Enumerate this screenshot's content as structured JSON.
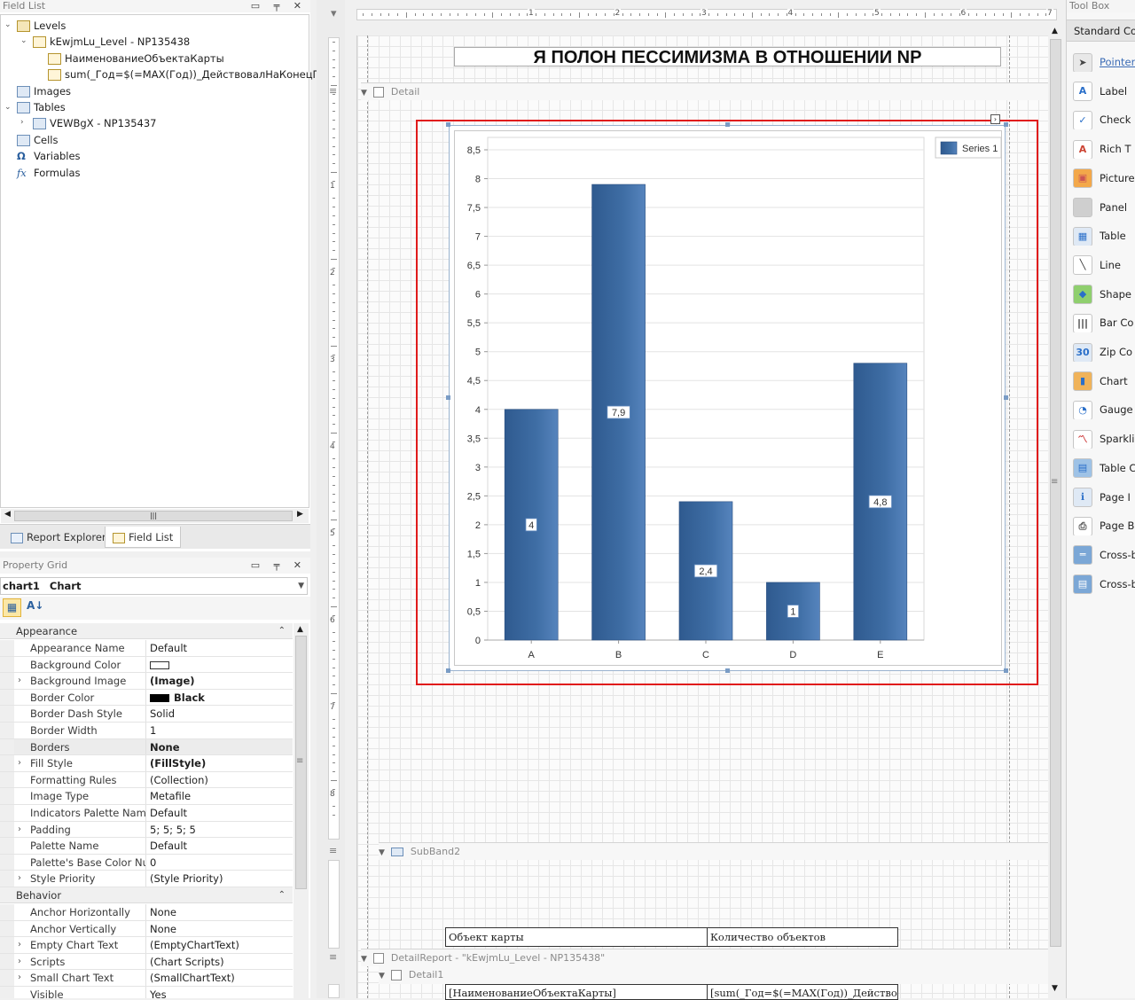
{
  "field_list": {
    "title": "Field List",
    "items": [
      {
        "label": "Levels"
      },
      {
        "label": "kEwjmLu_Level - NP135438"
      },
      {
        "label": "НаименованиеОбъектаКарты"
      },
      {
        "label": "sum(_Год=$(=MAX(Год))_ДействовалНаКонецГода)"
      },
      {
        "label": "Images"
      },
      {
        "label": "Tables"
      },
      {
        "label": "VEWBgX - NP135437"
      },
      {
        "label": "Cells"
      },
      {
        "label": "Variables"
      },
      {
        "label": "Formulas"
      }
    ],
    "tabs": [
      "Report Explorer",
      "Field List"
    ]
  },
  "property_grid": {
    "title": "Property Grid",
    "selected_object": "chart1",
    "selected_type": "Chart",
    "categories": [
      {
        "name": "Appearance",
        "rows": [
          {
            "key": "Appearance Name",
            "value": "Default"
          },
          {
            "key": "Background Color",
            "value": ""
          },
          {
            "key": "Background Image",
            "value": "(Image)"
          },
          {
            "key": "Border Color",
            "value": "Black"
          },
          {
            "key": "Border Dash Style",
            "value": "Solid"
          },
          {
            "key": "Border Width",
            "value": "1"
          },
          {
            "key": "Borders",
            "value": "None"
          },
          {
            "key": "Fill Style",
            "value": "(FillStyle)"
          },
          {
            "key": "Formatting Rules",
            "value": "(Collection)"
          },
          {
            "key": "Image Type",
            "value": "Metafile"
          },
          {
            "key": "Indicators Palette Name",
            "value": "Default"
          },
          {
            "key": "Padding",
            "value": "5; 5; 5; 5"
          },
          {
            "key": "Palette Name",
            "value": "Default"
          },
          {
            "key": "Palette's Base Color Number",
            "value": "0"
          },
          {
            "key": "Style Priority",
            "value": "(Style Priority)"
          }
        ]
      },
      {
        "name": "Behavior",
        "rows": [
          {
            "key": "Anchor Horizontally",
            "value": "None"
          },
          {
            "key": "Anchor Vertically",
            "value": "None"
          },
          {
            "key": "Empty Chart Text",
            "value": "(EmptyChartText)"
          },
          {
            "key": "Scripts",
            "value": "(Chart Scripts)"
          },
          {
            "key": "Small Chart Text",
            "value": "(SmallChartText)"
          },
          {
            "key": "Visible",
            "value": "Yes"
          }
        ]
      }
    ]
  },
  "designer": {
    "report_title": "Я ПОЛОН ПЕССИМИЗМА В ОТНОШЕНИИ NP",
    "band_detail": "Detail",
    "band_subband": "SubBand2",
    "band_detail_report": "DetailReport - \"kEwjmLu_Level - NP135438\"",
    "band_detail1": "Detail1",
    "table_header": [
      "Объект карты",
      "Количество объектов"
    ],
    "table_row": [
      "[НаименованиеОбъектаКарты]",
      "[sum(_Год=$(=MAX(Год))_Действо"
    ],
    "ruler_labels": [
      "1",
      "2",
      "3",
      "4",
      "5",
      "6",
      "7"
    ],
    "vruler_labels": [
      "1",
      "2",
      "3",
      "4",
      "5",
      "6",
      "7",
      "8"
    ]
  },
  "chart_data": {
    "type": "bar",
    "categories": [
      "A",
      "B",
      "C",
      "D",
      "E"
    ],
    "series": [
      {
        "name": "Series 1",
        "values": [
          4,
          7.9,
          2.4,
          1,
          4.8
        ],
        "labels": [
          "4",
          "7,9",
          "2,4",
          "1",
          "4,8"
        ]
      }
    ],
    "ylim": [
      0,
      8.5
    ],
    "yticks": [
      "0",
      "0,5",
      "1",
      "1,5",
      "2",
      "2,5",
      "3",
      "3,5",
      "4",
      "4,5",
      "5",
      "5,5",
      "6",
      "6,5",
      "7",
      "7,5",
      "8",
      "8,5"
    ],
    "legend": "top-right",
    "bar_color": "#3f6ea5",
    "grid": true
  },
  "toolbox": {
    "title": "Tool Box",
    "tab": "Standard Cont",
    "items": [
      {
        "label": "Pointer",
        "icon": "pointer-icon"
      },
      {
        "label": "Label",
        "icon": "label-icon"
      },
      {
        "label": "Check",
        "icon": "checkbox-icon"
      },
      {
        "label": "Rich T",
        "icon": "richtext-icon"
      },
      {
        "label": "Picture",
        "icon": "picture-icon"
      },
      {
        "label": "Panel",
        "icon": "panel-icon"
      },
      {
        "label": "Table",
        "icon": "table-icon"
      },
      {
        "label": "Line",
        "icon": "line-icon"
      },
      {
        "label": "Shape",
        "icon": "shape-icon"
      },
      {
        "label": "Bar Co",
        "icon": "barcode-icon"
      },
      {
        "label": "Zip Co",
        "icon": "zipcode-icon"
      },
      {
        "label": "Chart",
        "icon": "chart-icon"
      },
      {
        "label": "Gauge",
        "icon": "gauge-icon"
      },
      {
        "label": "Sparkli",
        "icon": "sparkline-icon"
      },
      {
        "label": "Table C",
        "icon": "table-contents-icon"
      },
      {
        "label": "Page I",
        "icon": "page-info-icon"
      },
      {
        "label": "Page B",
        "icon": "page-break-icon"
      },
      {
        "label": "Cross-b",
        "icon": "cross-band-line-icon"
      },
      {
        "label": "Cross-b",
        "icon": "cross-band-box-icon"
      }
    ]
  }
}
